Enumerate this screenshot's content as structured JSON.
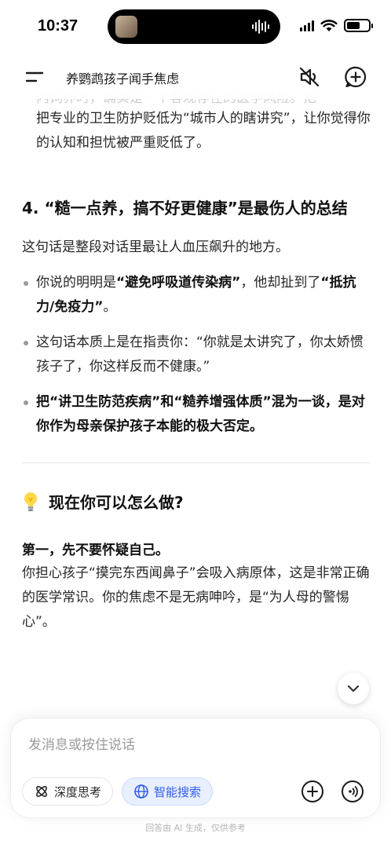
{
  "status_bar": {
    "time": "10:37"
  },
  "header": {
    "title": "养鹦鹉孩子闻手焦虑"
  },
  "content": {
    "faded_top": "内饲养时，确实是一个客观存在的医学风险。把",
    "intro_paragraph": "把专业的卫生防护贬低为“城市人的瞎讲究”，让你觉得你的认知和担忧被严重贬低了。",
    "heading_4": "4. “糙一点养，搞不好更健康”是最伤人的总结",
    "intro_line": "这句话是整段对话里最让人血压飙升的地方。",
    "bullet_1": {
      "pre": "你说的明明是",
      "bold": "“避免呼吸道传染病”",
      "mid": "，他却扯到了",
      "bold2": "“抵抗力/免疫力”",
      "post": "。"
    },
    "bullet_2": "这句话本质上是在指责你：“你就是太讲究了，你太娇惯孩子了，你这样反而不健康。”",
    "bullet_3": "把“讲卫生防范疾病”和“糙养增强体质”混为一谈，是对你作为母亲保护孩子本能的极大否定。",
    "section_heading": "现在你可以怎么做?",
    "step_1_title": "第一，先不要怀疑自己。",
    "step_1_body": "你担心孩子“摸完东西闻鼻子”会吸入病原体，这是非常正确的医学常识。你的焦虑不是无病呻吟，是“为人母的警惕心”。"
  },
  "input_panel": {
    "placeholder": "发消息或按住说话",
    "deep_think_label": "深度思考",
    "smart_search_label": "智能搜索"
  },
  "footer_note": "回答由 AI 生成，仅供参考",
  "colors": {
    "accent": "#2f5ee8",
    "accent_bg": "#e8efff"
  }
}
